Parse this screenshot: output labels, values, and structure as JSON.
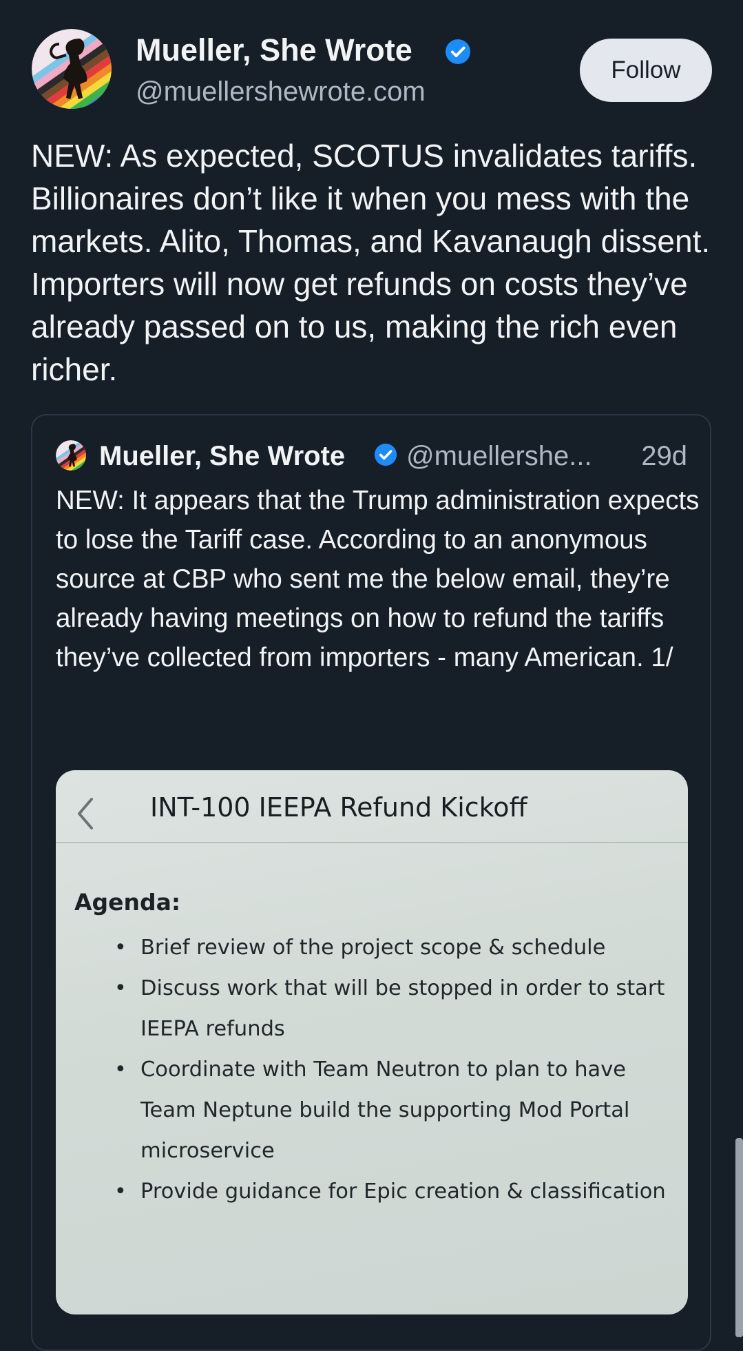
{
  "post": {
    "author": {
      "display_name": "Mueller, She Wrote",
      "handle": "@muellershewrote.com",
      "verified_icon": "verified-check-icon"
    },
    "follow_label": "Follow",
    "text": "NEW: As expected, SCOTUS invalidates tariffs. Billionaires don’t like it when you mess with the markets. Alito, Thomas, and Kavanaugh dissent. Importers will now get refunds on costs they’ve already passed on to us, making the rich even richer."
  },
  "quoted_post": {
    "author": {
      "display_name": "Mueller, She Wrote",
      "handle": "@muellershe...",
      "verified_icon": "verified-check-icon"
    },
    "time": "29d",
    "text": "NEW: It appears that the Trump administration expects to lose the Tariff case. According to an anonymous source at CBP who sent me the below email, they’re already having meetings on how to refund the tariffs they’ve collected from importers - many American. 1/",
    "image": {
      "title": "INT-100 IEEPA Refund Kickoff",
      "agenda_label": "Agenda:",
      "agenda_items": [
        "Brief review of the project scope & schedule",
        "Discuss work that will be stopped in order to start IEEPA refunds",
        "Coordinate with Team Neutron to plan to have Team Neptune build the supporting Mod Portal microservice",
        "Provide guidance for Epic creation & classification"
      ]
    }
  },
  "colors": {
    "background": "#161e27",
    "verified": "#1d8cf8",
    "follow_button": "#e4e8ee",
    "secondary_text": "#aeb9c5"
  }
}
